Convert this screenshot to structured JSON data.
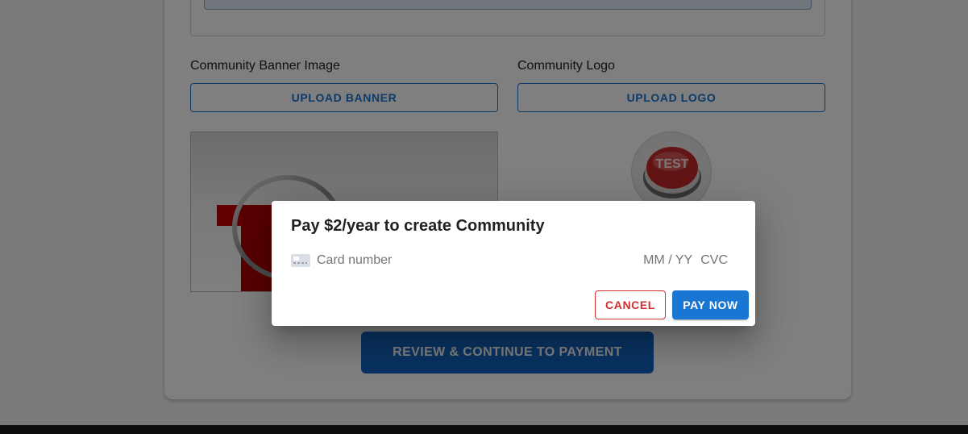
{
  "form": {
    "banner_label": "Community Banner Image",
    "logo_label": "Community Logo",
    "upload_banner_label": "UPLOAD BANNER",
    "upload_logo_label": "UPLOAD LOGO",
    "banner_preview_text": "T",
    "logo_preview_text": "TEST",
    "review_button_label": "REVIEW & CONTINUE TO PAYMENT"
  },
  "dialog": {
    "title": "Pay $2/year to create Community",
    "card_number_placeholder": "Card number",
    "expiry_placeholder": "MM / YY",
    "cvc_placeholder": "CVC",
    "cancel_label": "CANCEL",
    "pay_label": "PAY NOW"
  },
  "colors": {
    "primary": "#1976d2",
    "danger": "#d32f2f",
    "review_button": "#1565c0"
  },
  "icons": {
    "card_icon": "credit-card-icon"
  }
}
